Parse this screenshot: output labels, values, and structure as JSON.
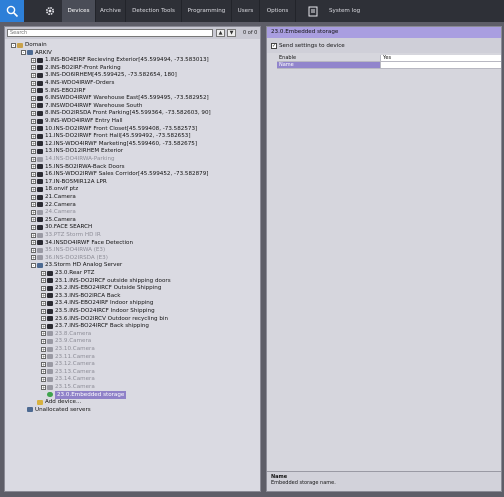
{
  "topbar": {
    "tabs": [
      {
        "label": "Devices",
        "active": true
      },
      {
        "label": "Archive",
        "active": false
      },
      {
        "label": "Detection Tools",
        "active": false
      },
      {
        "label": "Programming",
        "active": false
      },
      {
        "label": "Users",
        "active": false
      },
      {
        "label": "Options",
        "active": false
      }
    ],
    "syslog_label": "System log",
    "icons": [
      "network-search-icon",
      "gear-icon",
      "system-log-icon"
    ]
  },
  "left": {
    "search_placeholder": "Search",
    "search_count": "0 of 0",
    "tree": [
      {
        "label": "Domain",
        "level": 0,
        "icon": "domain",
        "expander": "-"
      },
      {
        "label": "ARKIV",
        "level": 1,
        "icon": "server",
        "expander": "-"
      },
      {
        "label": "1.INS-BO4EIRF Recieving Exterior[45.599494, -73.583013]",
        "level": 2,
        "icon": "cam",
        "expander": "+"
      },
      {
        "label": "2.INS-BO2IRF-Front Parking",
        "level": 2,
        "icon": "cam",
        "expander": "+"
      },
      {
        "label": "3.INS-DO6IRHEM[45.599425, -73.582654, 180]",
        "level": 2,
        "icon": "cam",
        "expander": "+"
      },
      {
        "label": "4.INS-WDO4IRWF-Orders",
        "level": 2,
        "icon": "cam",
        "expander": "+"
      },
      {
        "label": "5.INS-EBO2IRF",
        "level": 2,
        "icon": "cam",
        "expander": "+"
      },
      {
        "label": "6.INSWDO4IRWF Warehouse East[45.599495, -73.582952]",
        "level": 2,
        "icon": "cam",
        "expander": "+"
      },
      {
        "label": "7.INSWDO4IRWF Warehouse South",
        "level": 2,
        "icon": "cam",
        "expander": "+"
      },
      {
        "label": "8.INS-DO2IRSDA Front Parking[45.599364, -73.582603, 90]",
        "level": 2,
        "icon": "cam",
        "expander": "+"
      },
      {
        "label": "9.INS-WDO4IRWF Entry Hall",
        "level": 2,
        "icon": "cam",
        "expander": "+"
      },
      {
        "label": "10.INS-DO2IRWF Front Closet[45.599408, -73.582573]",
        "level": 2,
        "icon": "cam",
        "expander": "+"
      },
      {
        "label": "11.INS-DO2IRWF Front Hall[45.599492, -73.582653]",
        "level": 2,
        "icon": "cam",
        "expander": "+"
      },
      {
        "label": "12.INS-WDO4IRWF Marketing[45.599460, -73.582675]",
        "level": 2,
        "icon": "cam",
        "expander": "+"
      },
      {
        "label": "13.INS-DO12IRHEM Exterior",
        "level": 2,
        "icon": "cam",
        "expander": "+"
      },
      {
        "label": "14.INS-DO4IRWA-Parking",
        "level": 2,
        "icon": "camdis",
        "expander": "+",
        "dim": true
      },
      {
        "label": "15.INS-BO2IRWA-Back Doors",
        "level": 2,
        "icon": "cam",
        "expander": "+"
      },
      {
        "label": "16.INS-WDO2IRWF Sales Corridor[45.599452, -73.582879]",
        "level": 2,
        "icon": "cam",
        "expander": "+"
      },
      {
        "label": "17.IN-BO5MIR12A LPR",
        "level": 2,
        "icon": "cam",
        "expander": "+"
      },
      {
        "label": "18.onvif ptz",
        "level": 2,
        "icon": "cam",
        "expander": "+"
      },
      {
        "label": "21.Camera",
        "level": 2,
        "icon": "cam",
        "expander": "+"
      },
      {
        "label": "22.Camera",
        "level": 2,
        "icon": "cam",
        "expander": "+"
      },
      {
        "label": "24.Camera",
        "level": 2,
        "icon": "camdis",
        "expander": "+",
        "dim": true
      },
      {
        "label": "25.Camera",
        "level": 2,
        "icon": "cam",
        "expander": "+"
      },
      {
        "label": "30.FACE SEARCH",
        "level": 2,
        "icon": "cam",
        "expander": "+"
      },
      {
        "label": "33.PTZ Storm HD IR",
        "level": 2,
        "icon": "camdis",
        "expander": "+",
        "dim": true
      },
      {
        "label": "34.INSDO4IRWF Face Detection",
        "level": 2,
        "icon": "cam",
        "expander": "+"
      },
      {
        "label": "35.INS-DO4IRWA (E3)",
        "level": 2,
        "icon": "camdis",
        "expander": "+",
        "dim": true
      },
      {
        "label": "36.INS-DO2IRSDA (E3)",
        "level": 2,
        "icon": "camdis",
        "expander": "+",
        "dim": true
      },
      {
        "label": "23.Storm HD Analog Server",
        "level": 2,
        "icon": "server",
        "expander": "-"
      },
      {
        "label": "23.0.Rear PTZ",
        "level": 3,
        "icon": "cam",
        "expander": "+"
      },
      {
        "label": "23.1.INS-DO2IRCF outside shipping doors",
        "level": 3,
        "icon": "cam",
        "expander": "+"
      },
      {
        "label": "23.2.INS-EBO24IRCF Outside Shipping",
        "level": 3,
        "icon": "cam",
        "expander": "+"
      },
      {
        "label": "23.3.INS-BO2IRCA Back",
        "level": 3,
        "icon": "cam",
        "expander": "+"
      },
      {
        "label": "23.4.INS-EBO24IRF Indoor shipping",
        "level": 3,
        "icon": "cam",
        "expander": "+"
      },
      {
        "label": "23.5.INS-DO24IRCF Indoor Shipping",
        "level": 3,
        "icon": "cam",
        "expander": "+"
      },
      {
        "label": "23.6.INS-DO2IRCV Outdoor recycling bin",
        "level": 3,
        "icon": "cam",
        "expander": "+"
      },
      {
        "label": "23.7.INS-BO24IRCF Back shipping",
        "level": 3,
        "icon": "cam",
        "expander": "+"
      },
      {
        "label": "23.8.Camera",
        "level": 3,
        "icon": "camdis",
        "expander": "+",
        "dim": true
      },
      {
        "label": "23.9.Camera",
        "level": 3,
        "icon": "camdis",
        "expander": "+",
        "dim": true
      },
      {
        "label": "23.10.Camera",
        "level": 3,
        "icon": "camdis",
        "expander": "+",
        "dim": true
      },
      {
        "label": "23.11.Camera",
        "level": 3,
        "icon": "camdis",
        "expander": "+",
        "dim": true
      },
      {
        "label": "23.12.Camera",
        "level": 3,
        "icon": "camdis",
        "expander": "+",
        "dim": true
      },
      {
        "label": "23.13.Camera",
        "level": 3,
        "icon": "camdis",
        "expander": "+",
        "dim": true
      },
      {
        "label": "23.14.Camera",
        "level": 3,
        "icon": "camdis",
        "expander": "+",
        "dim": true
      },
      {
        "label": "23.15.Camera",
        "level": 3,
        "icon": "camdis",
        "expander": "+",
        "dim": true
      },
      {
        "label": "23.0.Embedded storage",
        "level": 3,
        "icon": "storage",
        "expander": "",
        "selected": true
      },
      {
        "label": "Add device...",
        "level": 2,
        "icon": "add",
        "expander": ""
      },
      {
        "label": "Unallocated servers",
        "level": 1,
        "icon": "server",
        "expander": ""
      }
    ]
  },
  "right": {
    "title": "23.0.Embedded storage",
    "send_settings_label": "Send settings to device",
    "send_settings_checked": true,
    "properties": [
      {
        "name": "Enable",
        "value": "Yes",
        "selected": false
      },
      {
        "name": "Name",
        "value": "",
        "selected": true
      }
    ],
    "desc_name": "Name",
    "desc_text": "Embedded storage name."
  },
  "colors": {
    "topbar_bg": "#2e3037",
    "selection": "#8f81c8",
    "title_bar": "#a99ee0"
  }
}
